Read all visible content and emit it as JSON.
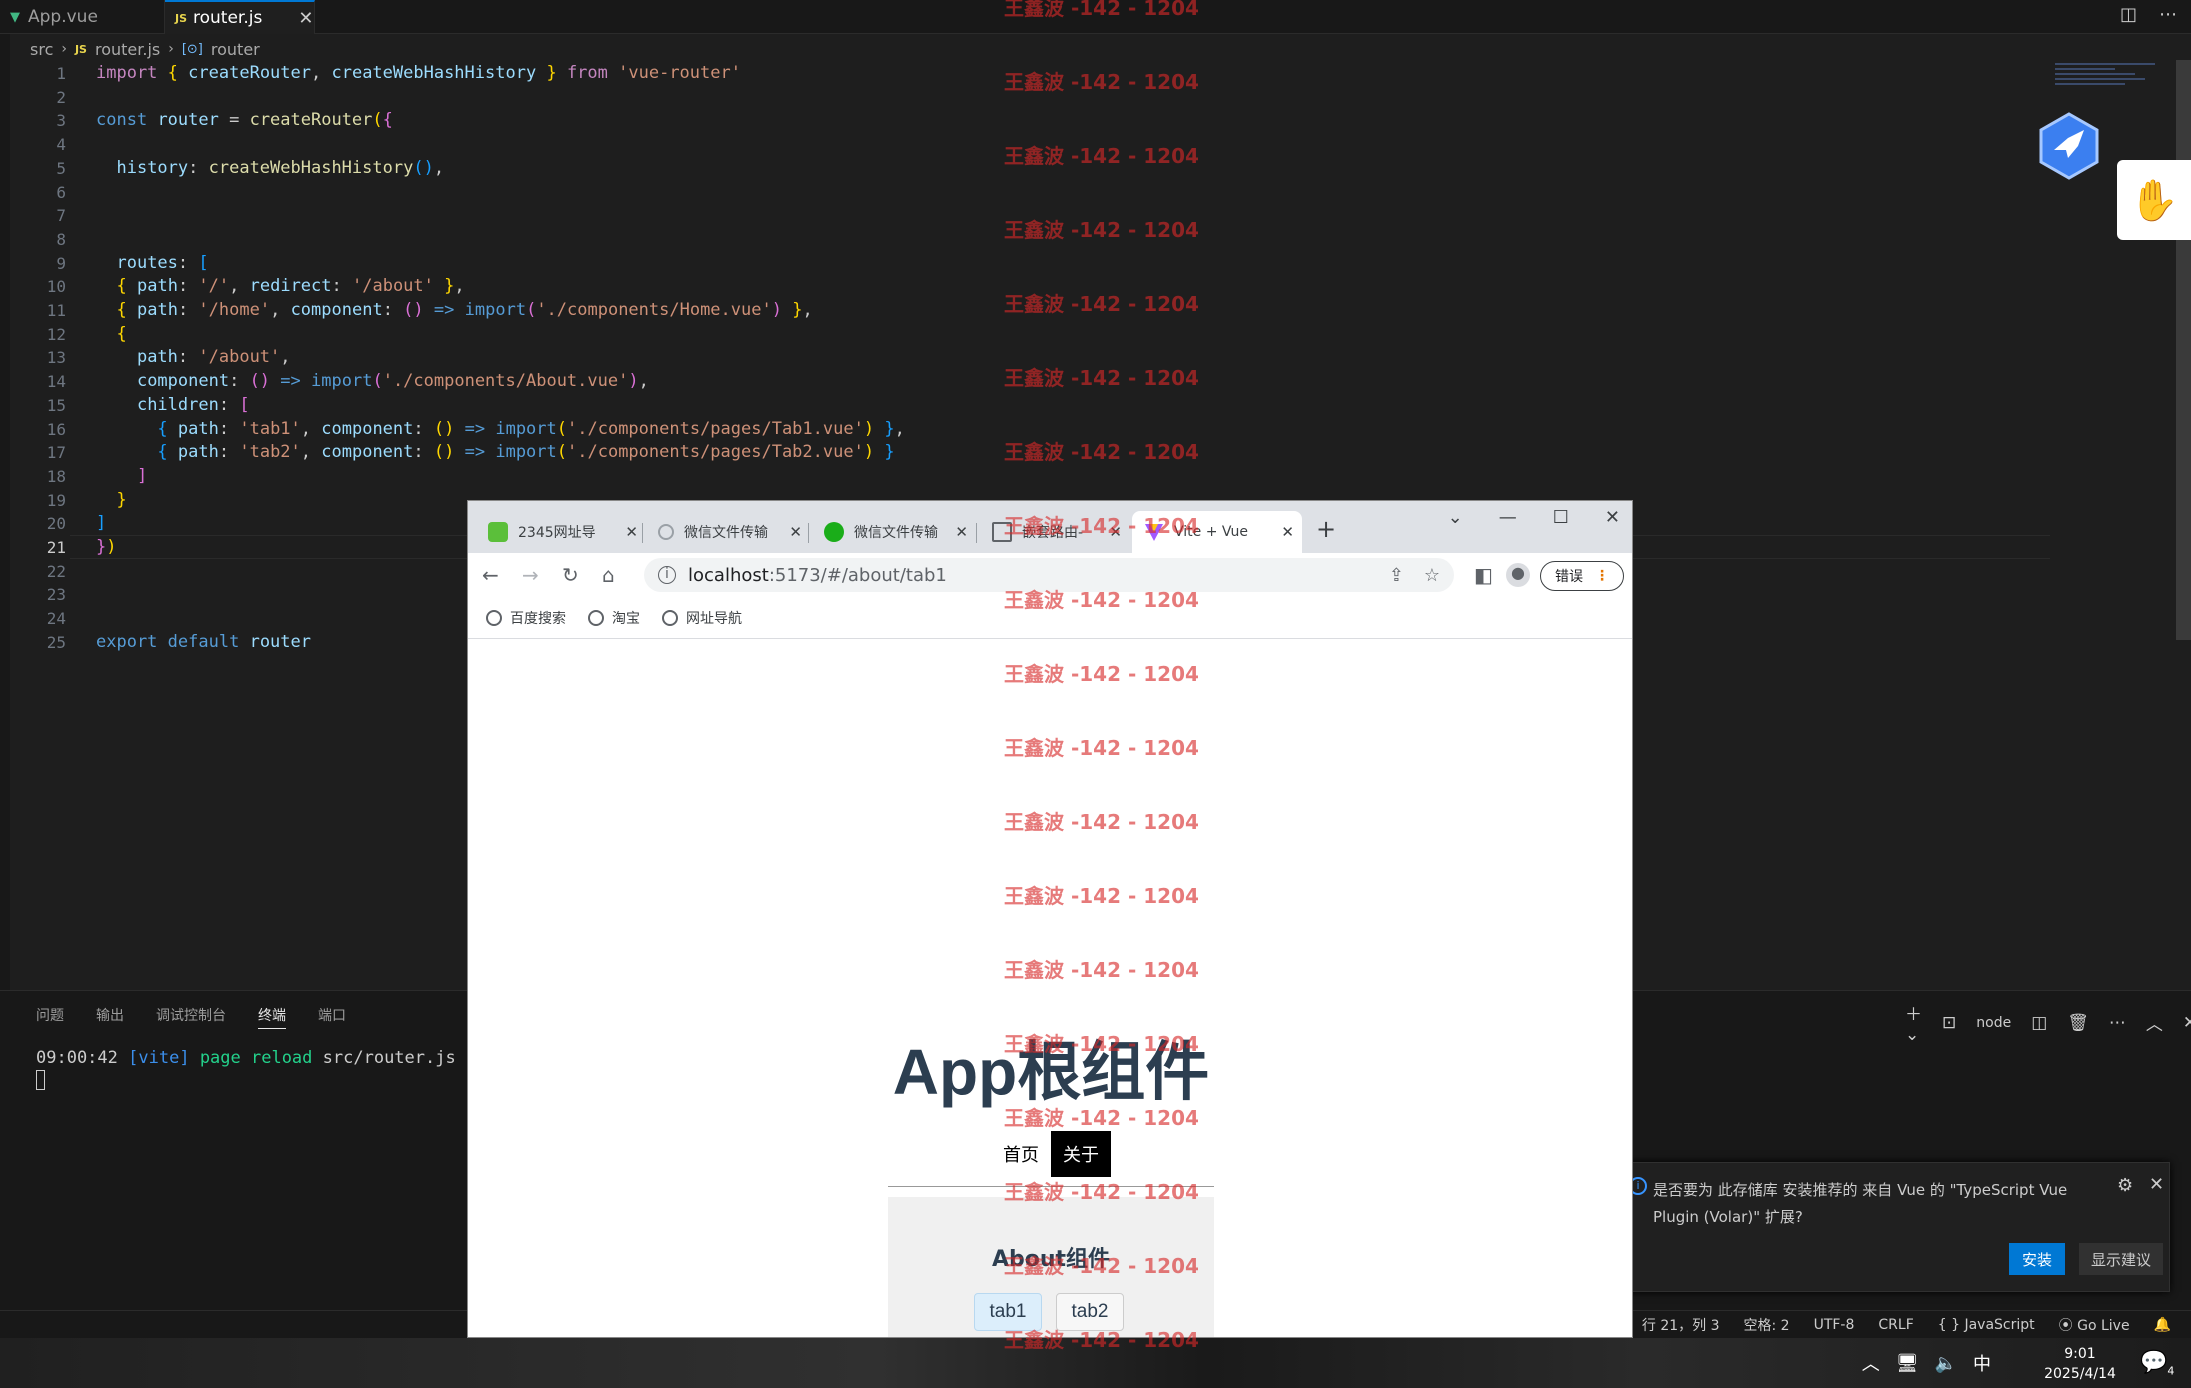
{
  "editor": {
    "tabs": [
      {
        "label": "App.vue",
        "icon": "vue-icon",
        "active": false
      },
      {
        "label": "router.js",
        "icon": "js-icon",
        "active": true
      }
    ],
    "js_badge": "JS",
    "breadcrumb": [
      "src",
      "router.js",
      "router"
    ],
    "line_numbers": [
      "1",
      "2",
      "3",
      "4",
      "5",
      "6",
      "7",
      "8",
      "9",
      "10",
      "11",
      "12",
      "13",
      "14",
      "15",
      "16",
      "17",
      "18",
      "19",
      "20",
      "21",
      "22",
      "23",
      "24",
      "25"
    ],
    "current_line": "21"
  },
  "panel": {
    "tabs": [
      "问题",
      "输出",
      "调试控制台",
      "终端",
      "端口"
    ],
    "active_tab": "终端",
    "shell_label": "node",
    "terminal_time": "09:00:42",
    "terminal_tag": "[vite]",
    "terminal_action": "page reload",
    "terminal_file": "src/router.js"
  },
  "notification": {
    "message": "是否要为 此存储库 安装推荐的 来自 Vue 的 \"TypeScript Vue Plugin (Volar)\" 扩展?",
    "install_label": "安装",
    "suggest_label": "显示建议"
  },
  "statusbar": {
    "position": "行 21，列 3",
    "spaces": "空格: 2",
    "encoding": "UTF-8",
    "eol": "CRLF",
    "language": "{ } JavaScript",
    "golive": "Go Live"
  },
  "taskbar": {
    "ime": "中",
    "time": "9:01",
    "date": "2025/4/14",
    "notif_count": "4"
  },
  "browser": {
    "tabs": [
      {
        "label": "2345网址导",
        "icon": "2345-icon"
      },
      {
        "label": "微信文件传输",
        "icon": "search-icon"
      },
      {
        "label": "微信文件传输",
        "icon": "wechat-icon"
      },
      {
        "label": "嵌套路由-",
        "icon": "image-icon"
      },
      {
        "label": "Vite + Vue",
        "icon": "vite-icon",
        "active": true
      }
    ],
    "url_host": "localhost",
    "url_path": ":5173/#/about/tab1",
    "error_label": "错误",
    "bookmarks": [
      "百度搜索",
      "淘宝",
      "网址导航"
    ]
  },
  "page": {
    "title": "App根组件",
    "nav": [
      "首页",
      "关于"
    ],
    "nav_selected": "关于",
    "about_title": "About组件",
    "sub_tabs": [
      "tab1",
      "tab2"
    ],
    "active_sub_tab": "tab1"
  },
  "watermark": "王鑫波 -142 - 1204",
  "colors": {
    "editor_bg": "#1e1e1e",
    "accent": "#0078d4",
    "watermark": "#d62828",
    "page_title": "#2c3e50"
  }
}
